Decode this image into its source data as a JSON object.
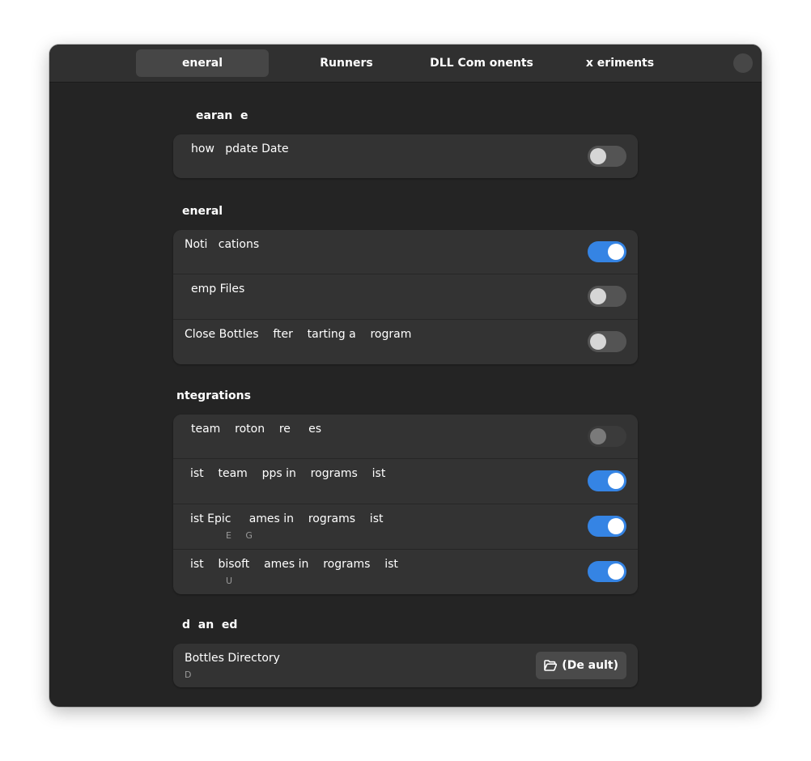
{
  "tabs": [
    {
      "label": "eneral",
      "active": true
    },
    {
      "label": "Runners",
      "active": false
    },
    {
      "label": "DLL Com  onents",
      "active": false
    },
    {
      "label": "x  eriments",
      "active": false
    }
  ],
  "sections": {
    "appearance": {
      "title": "earan  e",
      "rows": [
        {
          "title": "how   pdate Date",
          "state": "off"
        }
      ]
    },
    "general": {
      "title": "eneral",
      "rows": [
        {
          "title": "Noti   cations",
          "state": "on"
        },
        {
          "title": "emp Files",
          "state": "off"
        },
        {
          "title": "Close Bottles    fter    tarting a    rogram",
          "state": "off"
        }
      ]
    },
    "integrations": {
      "title": "ntegrations",
      "rows": [
        {
          "title": "team    roton    re     es",
          "state": "disabled"
        },
        {
          "title": "ist    team    pps in    rograms    ist",
          "state": "on"
        },
        {
          "title": "ist Epic     ames in    rograms    ist",
          "subtitle": "E     G",
          "state": "on"
        },
        {
          "title": "ist    bisoft    ames in    rograms    ist",
          "subtitle": "U",
          "state": "on"
        }
      ]
    },
    "advanced": {
      "title": "d  an  ed",
      "rows": [
        {
          "title": "Bottles Directory",
          "subtitle": "D",
          "button_label": "(De ault)",
          "button_icon": "folder-open-icon"
        }
      ]
    }
  },
  "colors": {
    "window_bg": "#242424",
    "header_bg": "#303030",
    "group_bg": "#333333",
    "accent": "#3584e4"
  }
}
